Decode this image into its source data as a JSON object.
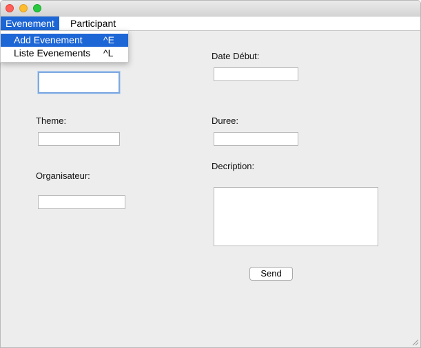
{
  "menubar": {
    "menus": [
      {
        "label": "Evenement",
        "active": true
      },
      {
        "label": "Participant",
        "active": false
      }
    ]
  },
  "dropdown": {
    "items": [
      {
        "label": "Add Evenement",
        "shortcut": "^E",
        "selected": true
      },
      {
        "label": "Liste Evenements",
        "shortcut": "^L",
        "selected": false
      }
    ]
  },
  "form": {
    "theme_label": "Theme:",
    "organisateur_label": "Organisateur:",
    "date_debut_label": "Date Début:",
    "duree_label": "Duree:",
    "description_label": "Decription:",
    "send_label": "Send"
  },
  "colors": {
    "menu_highlight": "#1d66d6",
    "window_bg": "#ededed",
    "close": "#fe5f57",
    "minimize": "#febc2e",
    "maximize": "#28c840"
  }
}
